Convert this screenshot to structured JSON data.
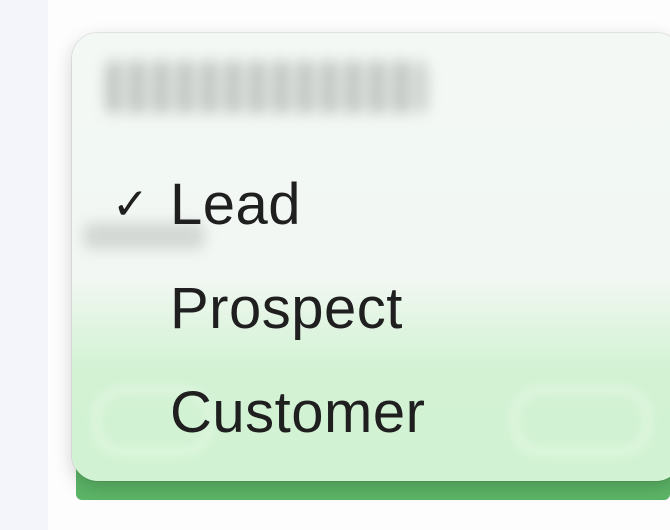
{
  "menu": {
    "items": [
      {
        "label": "Lead",
        "selected": true
      },
      {
        "label": "Prospect",
        "selected": false
      },
      {
        "label": "Customer",
        "selected": false
      }
    ],
    "check_glyph": "✓"
  },
  "colors": {
    "background_green": "#5cb567",
    "menu_tint_top": "#f3f8f4",
    "menu_tint_bottom": "#d2f3d3",
    "text": "#1f1f1f"
  }
}
